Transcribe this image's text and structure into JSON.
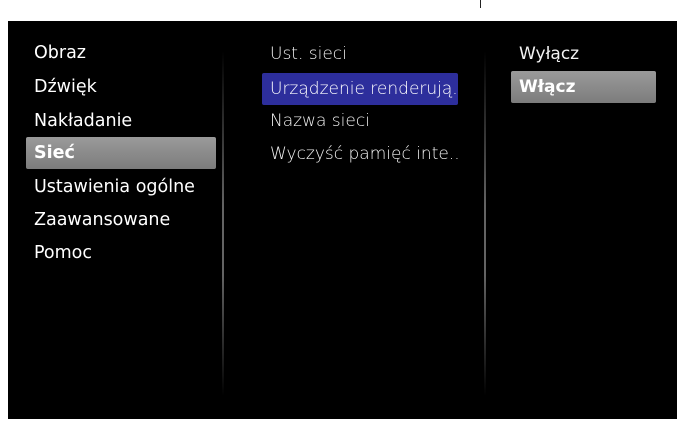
{
  "menu": {
    "categories": [
      {
        "label": "Obraz"
      },
      {
        "label": "Dźwięk"
      },
      {
        "label": "Nakładanie"
      },
      {
        "label": "Sieć"
      },
      {
        "label": "Ustawienia ogólne"
      },
      {
        "label": "Zaawansowane"
      },
      {
        "label": "Pomoc"
      }
    ],
    "selected_category": "Sieć",
    "network_items": [
      {
        "label": "Ust. sieci"
      },
      {
        "label": "Urządzenie renderują..."
      },
      {
        "label": "Nazwa sieci"
      },
      {
        "label": "Wyczyść pamięć inte..."
      }
    ],
    "focused_item": "Urządzenie renderują...",
    "options": [
      {
        "label": "Wyłącz"
      },
      {
        "label": "Włącz"
      }
    ],
    "selected_option": "Włącz"
  },
  "colors": {
    "background": "#000000",
    "focus_highlight": "#2d2e9c",
    "selection_highlight": "#8a8a8a",
    "text": "#ffffff"
  }
}
